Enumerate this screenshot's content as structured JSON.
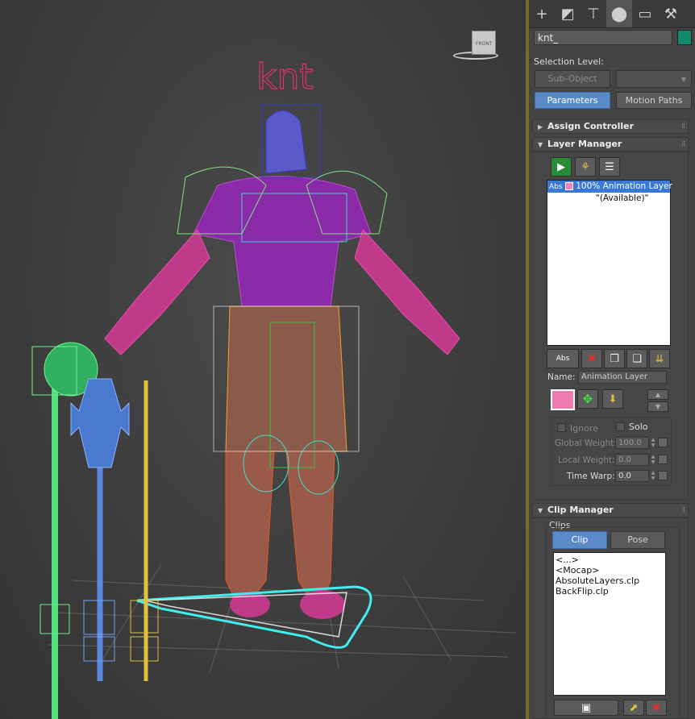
{
  "viewport": {
    "object_label": "knt",
    "viewcube_label": "FRONT"
  },
  "panel": {
    "tabs": [
      {
        "icon": "create-plus-icon",
        "glyph": "+"
      },
      {
        "icon": "modify-icon",
        "glyph": "◩"
      },
      {
        "icon": "hierarchy-icon",
        "glyph": "⊤"
      },
      {
        "icon": "motion-icon",
        "glyph": "⬤"
      },
      {
        "icon": "display-icon",
        "glyph": "▭"
      },
      {
        "icon": "utilities-icon",
        "glyph": "⚒"
      }
    ],
    "object_name": "knt_",
    "object_color": "#138a6a",
    "selection_level_label": "Selection Level:",
    "sub_object_label": "Sub-Object",
    "parameters_label": "Parameters",
    "motion_paths_label": "Motion Paths",
    "assign_controller_title": "Assign Controller",
    "layer_manager": {
      "title": "Layer Manager",
      "layers": [
        {
          "tag": "Abs",
          "weight": "100%",
          "name": "Animation Layer"
        }
      ],
      "available_item": "\"(Available)\"",
      "abs_button_label": "Abs",
      "name_label": "Name:",
      "name_value": "Animation Layer",
      "ignore_label": "Ignore",
      "solo_label": "Solo",
      "global_weight_label": "Global Weight:",
      "global_weight_value": "100.0",
      "local_weight_label": "Local Weight:",
      "local_weight_value": "0.0",
      "time_warp_label": "Time Warp:",
      "time_warp_value": "0.0"
    },
    "clip_manager": {
      "title": "Clip Manager",
      "clips_group_label": "Clips",
      "clip_tab_label": "Clip",
      "pose_tab_label": "Pose",
      "items": [
        "<...>",
        "<Mocap>",
        "AbsoluteLayers.clp",
        "BackFlip.clp"
      ]
    }
  }
}
